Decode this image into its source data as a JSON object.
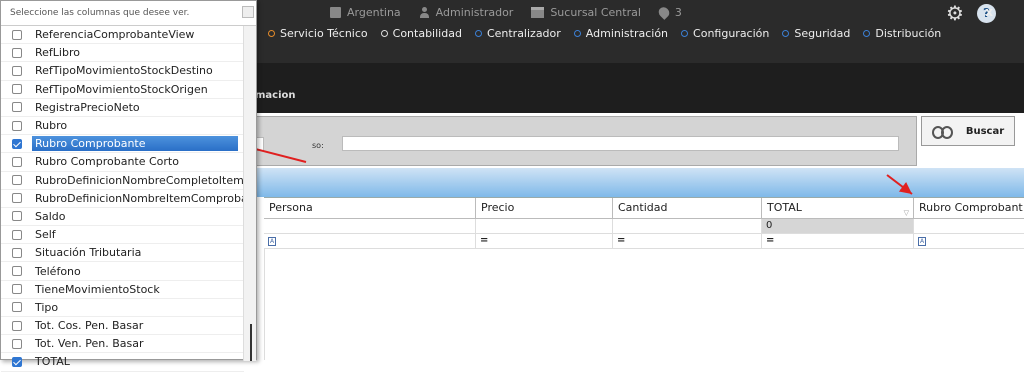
{
  "header": {
    "country": "Argentina",
    "user": "Administrador",
    "branch": "Sucursal Central",
    "location_count": "3",
    "close": "x",
    "help": "?"
  },
  "menu": [
    {
      "label": "Servicio Técnico"
    },
    {
      "label": "Contabilidad"
    },
    {
      "label": "Centralizador"
    },
    {
      "label": "Administración"
    },
    {
      "label": "Configuración"
    },
    {
      "label": "Seguridad"
    },
    {
      "label": "Distribución"
    }
  ],
  "band": {
    "tab_label": "macion"
  },
  "search": {
    "so_label": "so:",
    "button_label": "Buscar"
  },
  "grid": {
    "columns": [
      "Persona",
      "Precio",
      "Cantidad",
      "TOTAL",
      "Rubro Comprobant"
    ],
    "total_value": "0",
    "filter_eq": "="
  },
  "chooser": {
    "title": "Seleccione las columnas que desee ver.",
    "items": [
      {
        "label": "ReferenciaComprobanteView",
        "checked": false
      },
      {
        "label": "RefLibro",
        "checked": false
      },
      {
        "label": "RefTipoMovimientoStockDestino",
        "checked": false
      },
      {
        "label": "RefTipoMovimientoStockOrigen",
        "checked": false
      },
      {
        "label": "RegistraPrecioNeto",
        "checked": false
      },
      {
        "label": "Rubro",
        "checked": false
      },
      {
        "label": "Rubro Comprobante",
        "checked": true
      },
      {
        "label": "Rubro Comprobante Corto",
        "checked": false
      },
      {
        "label": "RubroDefinicionNombreCompletoItemC",
        "checked": false
      },
      {
        "label": "RubroDefinicionNombreItemComproban",
        "checked": false
      },
      {
        "label": "Saldo",
        "checked": false
      },
      {
        "label": "Self",
        "checked": false
      },
      {
        "label": "Situación Tributaria",
        "checked": false
      },
      {
        "label": "Teléfono",
        "checked": false
      },
      {
        "label": "TieneMovimientoStock",
        "checked": false
      },
      {
        "label": "Tipo",
        "checked": false
      },
      {
        "label": "Tot. Cos. Pen. Basar",
        "checked": false
      },
      {
        "label": "Tot. Ven. Pen. Basar",
        "checked": false
      },
      {
        "label": "TOTAL",
        "checked": true
      }
    ]
  }
}
